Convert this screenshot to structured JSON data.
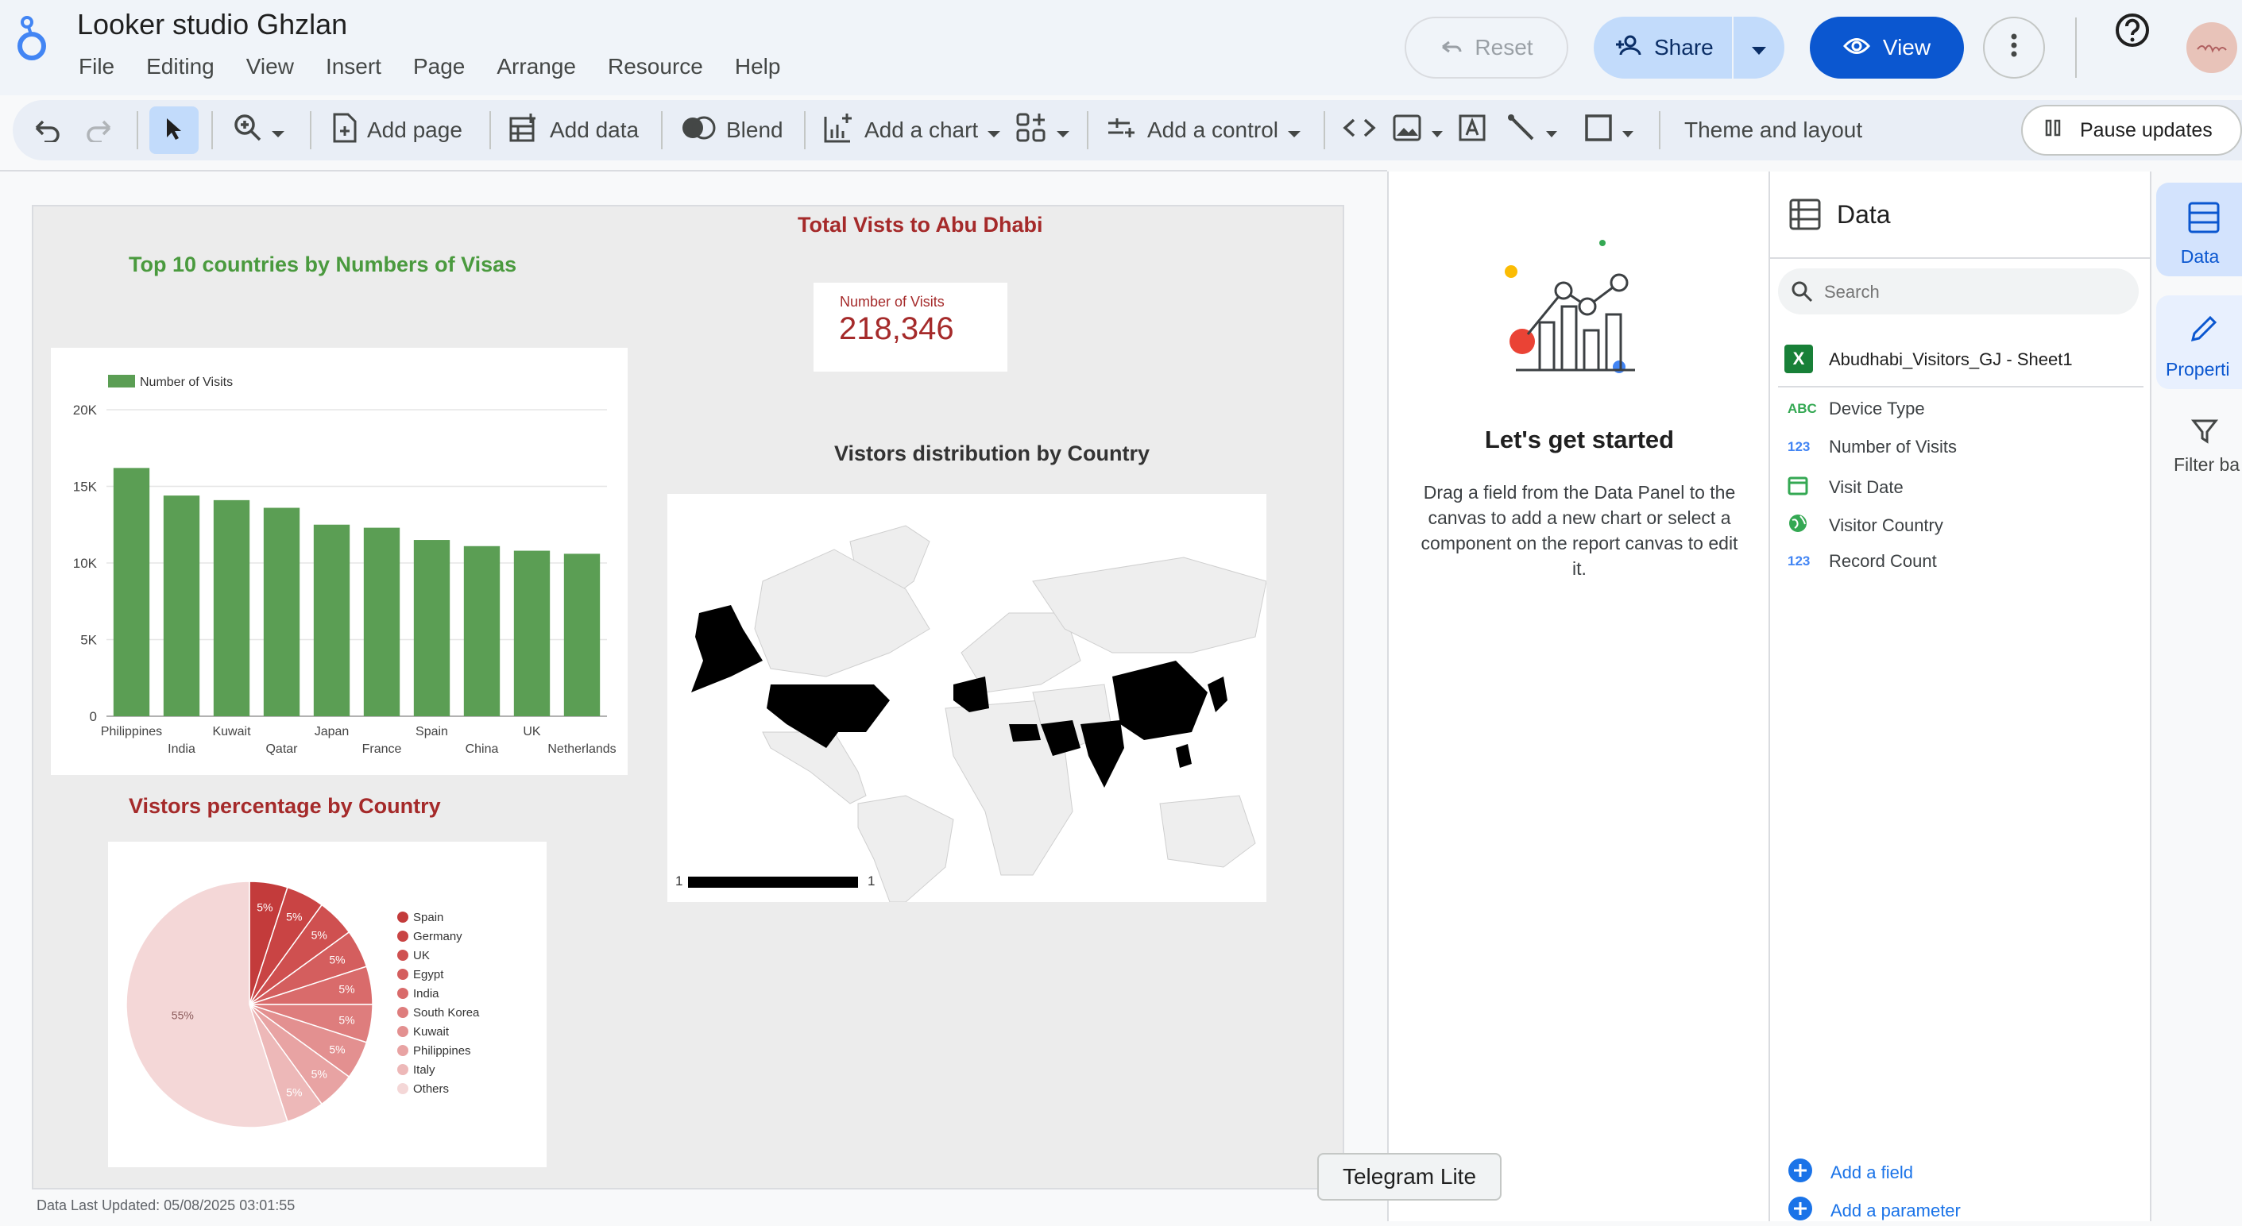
{
  "app": {
    "title": "Looker studio Ghzlan"
  },
  "menu": [
    "File",
    "Editing",
    "View",
    "Insert",
    "Page",
    "Arrange",
    "Resource",
    "Help"
  ],
  "header_buttons": {
    "reset": "Reset",
    "share": "Share",
    "view": "View"
  },
  "toolbar": {
    "add_page": "Add page",
    "add_data": "Add data",
    "blend": "Blend",
    "add_chart": "Add a chart",
    "add_control": "Add a control",
    "theme_layout": "Theme and layout",
    "pause_updates": "Pause updates"
  },
  "report": {
    "bar_title": "Top 10 countries by Numbers of Visas",
    "total_title": "Total Vists to Abu Dhabi",
    "scorecard_label": "Number of Visits",
    "scorecard_value": "218,346",
    "map_title": "Vistors distribution by Country",
    "pie_title": "Vistors percentage by Country",
    "map_legend_min": "1",
    "map_legend_max": "1",
    "footer": "Data Last Updated: 05/08/2025 03:01:55"
  },
  "colors": {
    "green_bar": "#5b9e54",
    "title_green": "#4a9a3e",
    "title_red": "#a52a2a",
    "accent_blue": "#0b57d0"
  },
  "chart_data": [
    {
      "type": "bar",
      "title": "Top 10 countries by Numbers of Visas",
      "categories": [
        "Philippines",
        "India",
        "Kuwait",
        "Qatar",
        "Japan",
        "France",
        "Spain",
        "China",
        "UK",
        "Netherlands"
      ],
      "series": [
        {
          "name": "Number of Visits",
          "values": [
            16200,
            14400,
            14100,
            13600,
            12500,
            12300,
            11500,
            11100,
            10800,
            10600
          ]
        }
      ],
      "yticks": [
        "0",
        "5K",
        "10K",
        "15K",
        "20K"
      ],
      "ylim": [
        0,
        20000
      ],
      "legend": "top-left",
      "grid": true
    },
    {
      "type": "pie",
      "title": "Vistors percentage by Country",
      "labels": [
        "Spain",
        "Germany",
        "UK",
        "Egypt",
        "India",
        "South Korea",
        "Kuwait",
        "Philippines",
        "Italy",
        "Others"
      ],
      "values": [
        5,
        5,
        5,
        5,
        5,
        5,
        5,
        5,
        5,
        55
      ],
      "label_text": [
        "5%",
        "5%",
        "5%",
        "5%",
        "5%",
        "5%",
        "5%",
        "5%",
        "5%",
        "55%"
      ],
      "colors": [
        "#c33b3b",
        "#c94444",
        "#cf5050",
        "#d45e5e",
        "#d96b6b",
        "#de7d7d",
        "#e39090",
        "#e8a3a3",
        "#edb8b8",
        "#f4d7d7"
      ],
      "legend": "right"
    }
  ],
  "get_started": {
    "title": "Let's get started",
    "body": "Drag a field from the Data Panel to the canvas to add a new chart or select a component on the report canvas to edit it."
  },
  "data_panel": {
    "title": "Data",
    "search_placeholder": "Search",
    "source": "Abudhabi_Visitors_GJ - Sheet1",
    "fields": [
      {
        "type": "ABC",
        "name": "Device Type"
      },
      {
        "type": "123",
        "name": "Number of Visits"
      },
      {
        "type": "date",
        "name": "Visit Date"
      },
      {
        "type": "geo",
        "name": "Visitor Country"
      },
      {
        "type": "123",
        "name": "Record Count"
      }
    ],
    "add_field": "Add a field",
    "add_parameter": "Add a parameter"
  },
  "right_rail": {
    "data": "Data",
    "properties": "Properti",
    "filter": "Filter ba"
  },
  "tooltip": "Telegram Lite"
}
